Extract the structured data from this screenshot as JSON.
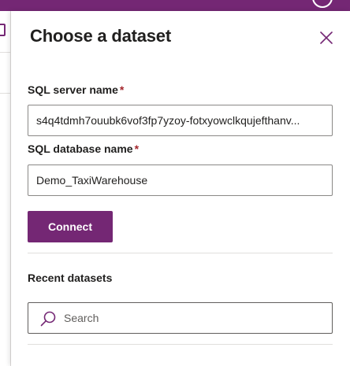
{
  "app": {
    "accent_color": "#742774",
    "required_color": "#a4262c"
  },
  "panel": {
    "title": "Choose a dataset",
    "close_icon": "close-icon"
  },
  "form": {
    "server": {
      "label": "SQL server name",
      "required_mark": "*",
      "value": "s4q4tdmh7ouubk6vof3fp7yzoy-fotxyowclkqujefthanv..."
    },
    "database": {
      "label": "SQL database name",
      "required_mark": "*",
      "value": "Demo_TaxiWarehouse"
    },
    "connect_label": "Connect"
  },
  "recent": {
    "label": "Recent datasets",
    "search_placeholder": "Search",
    "search_icon": "search-icon"
  }
}
